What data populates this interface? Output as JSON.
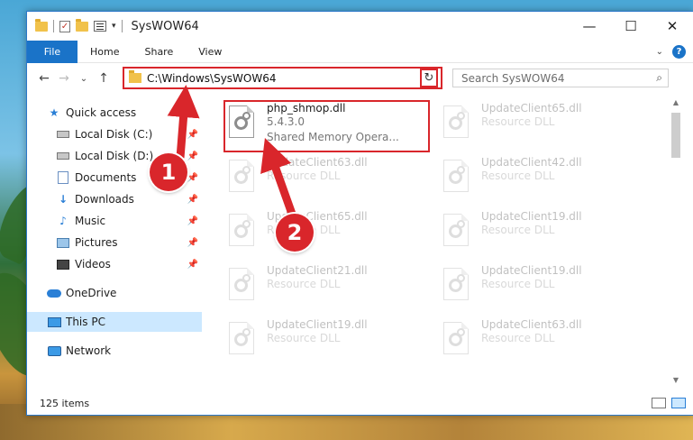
{
  "window": {
    "title": "SysWOW64",
    "controls": {
      "minimize": "—",
      "maximize": "☐",
      "close": "✕"
    }
  },
  "ribbon": {
    "tabs": [
      "File",
      "Home",
      "Share",
      "View"
    ],
    "help_glyph": "?",
    "collapse_glyph": "⌄"
  },
  "nav": {
    "back": "←",
    "forward": "→",
    "recent": "⌄",
    "up": "↑"
  },
  "address": {
    "path": "C:\\Windows\\SysWOW64",
    "dropdown": "⌄",
    "refresh": "↻"
  },
  "search": {
    "placeholder": "Search SysWOW64",
    "icon": "⌕"
  },
  "sidebar": {
    "items": [
      {
        "label": "Quick access",
        "icon": "star-icon",
        "pinned": false
      },
      {
        "label": "Local Disk (C:)",
        "icon": "disk-icon",
        "pinned": true
      },
      {
        "label": "Local Disk (D:)",
        "icon": "disk-icon",
        "pinned": true
      },
      {
        "label": "Documents",
        "icon": "documents-icon",
        "pinned": true
      },
      {
        "label": "Downloads",
        "icon": "download-icon",
        "pinned": true
      },
      {
        "label": "Music",
        "icon": "music-icon",
        "pinned": true
      },
      {
        "label": "Pictures",
        "icon": "pictures-icon",
        "pinned": true
      },
      {
        "label": "Videos",
        "icon": "videos-icon",
        "pinned": true
      },
      {
        "label": "OneDrive",
        "icon": "cloud-icon",
        "pinned": false
      },
      {
        "label": "This PC",
        "icon": "pc-icon",
        "pinned": false,
        "selected": true
      },
      {
        "label": "Network",
        "icon": "network-icon",
        "pinned": false
      }
    ],
    "pin_glyph": "📌"
  },
  "files": [
    {
      "name": "php_shmop.dll",
      "line2": "5.4.3.0",
      "line3": "Shared Memory Opera...",
      "highlighted": true
    },
    {
      "name": "UpdateClient65.dll",
      "line2": "Resource DLL"
    },
    {
      "name": "UpdateClient63.dll",
      "line2": "Resource DLL"
    },
    {
      "name": "UpdateClient42.dll",
      "line2": "Resource DLL"
    },
    {
      "name": "UpdateClient65.dll",
      "line2": "Resource DLL"
    },
    {
      "name": "UpdateClient19.dll",
      "line2": "Resource DLL"
    },
    {
      "name": "UpdateClient21.dll",
      "line2": "Resource DLL"
    },
    {
      "name": "UpdateClient19.dll",
      "line2": "Resource DLL"
    },
    {
      "name": "UpdateClient19.dll",
      "line2": "Resource DLL"
    },
    {
      "name": "UpdateClient63.dll",
      "line2": "Resource DLL"
    }
  ],
  "status": {
    "item_count": "125 items"
  },
  "annotations": {
    "step1": "1",
    "step2": "2"
  },
  "colors": {
    "accent": "#1a73c8",
    "highlight": "#d9262b",
    "selection": "#cce8ff"
  }
}
